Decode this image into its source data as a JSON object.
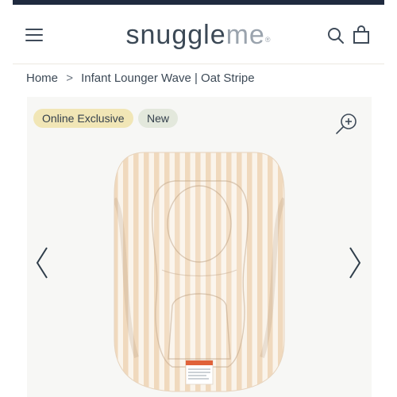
{
  "header": {
    "logo_main": "snuggle",
    "logo_accent": "me",
    "logo_mark": "®",
    "menu_icon": "hamburger-menu-icon",
    "search_icon": "search-icon",
    "bag_icon": "shopping-bag-icon"
  },
  "breadcrumb": {
    "home": "Home",
    "separator": ">",
    "current": "Infant Lounger Wave | Oat Stripe"
  },
  "product": {
    "badges": {
      "exclusive": "Online Exclusive",
      "new": "New"
    },
    "zoom_icon": "zoom-in-icon",
    "prev_icon": "chevron-left-icon",
    "next_icon": "chevron-right-icon",
    "image_alt": "Infant Lounger Wave in Oat Stripe"
  },
  "colors": {
    "top_bar": "#1f2a3f",
    "badge_exclusive": "#f1e6b6",
    "badge_new": "#e3e8dc",
    "stripe": "#efd6b8",
    "base": "#faf3ea",
    "label": "#e0623a"
  }
}
